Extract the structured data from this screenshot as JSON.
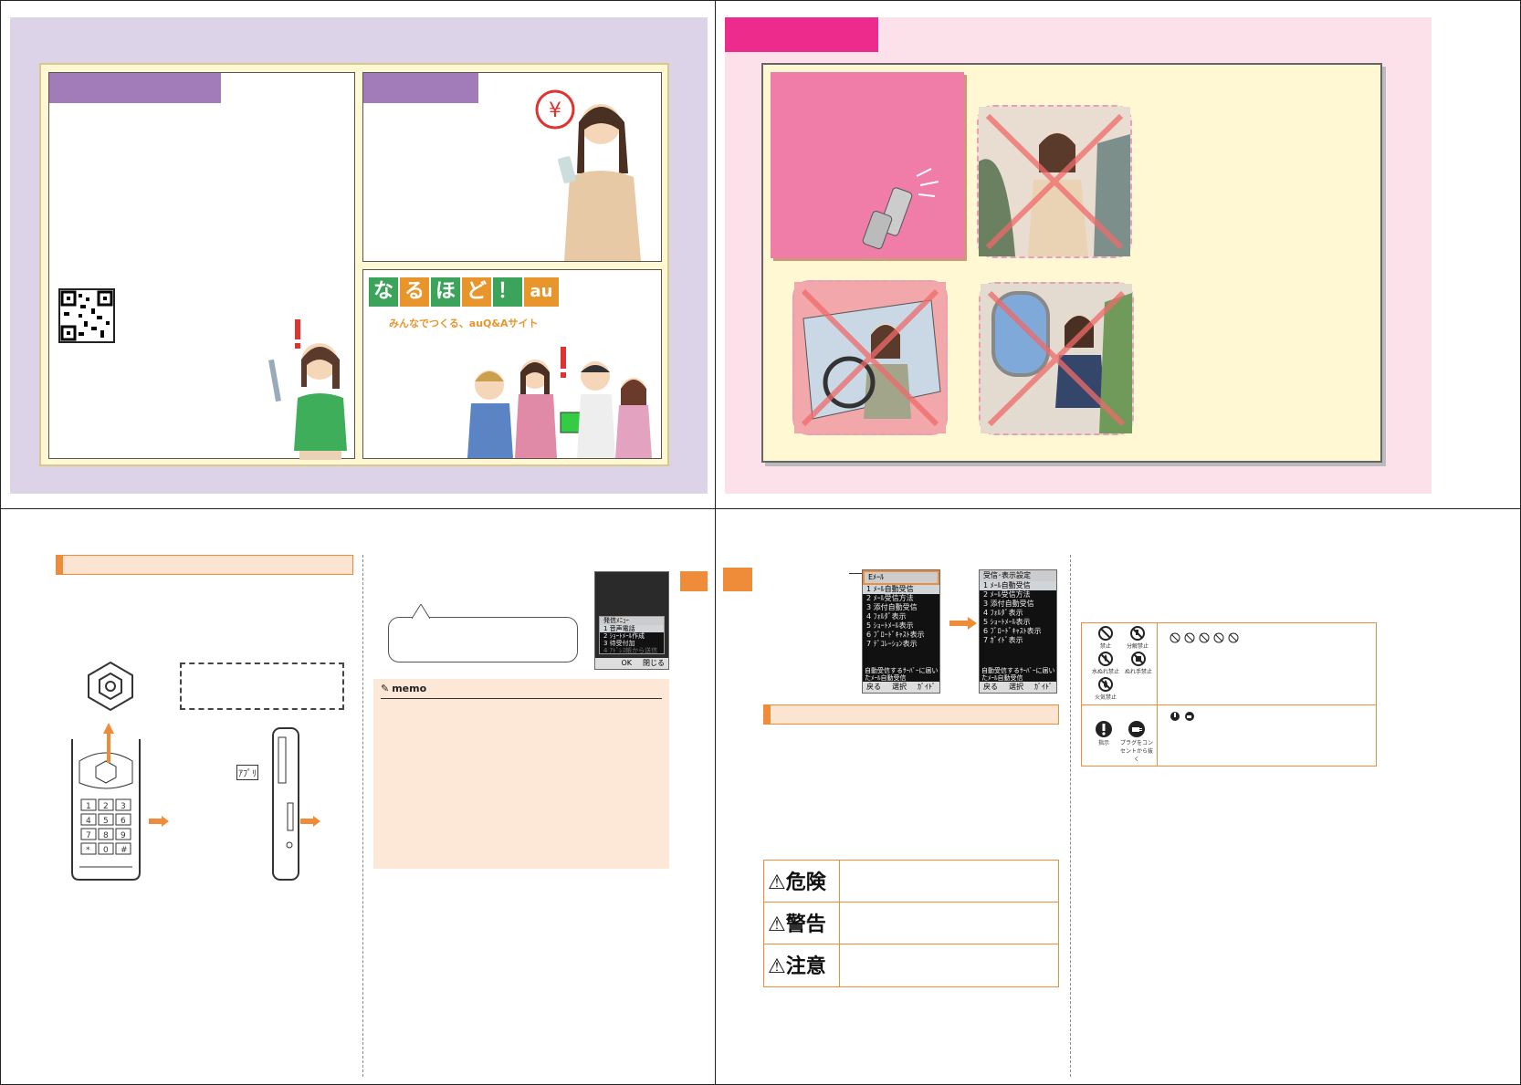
{
  "colors": {
    "lavender_bg": "#dcd3e8",
    "pink_bg": "#fde1ea",
    "cream": "#fff8d2",
    "purple_tab": "#a27bb9",
    "magenta_tab": "#ec2b8c",
    "orange": "#ef8c3a",
    "pink_panel": "#f07ca8"
  },
  "q2": {
    "logo_chars": [
      "な",
      "る",
      "ほ",
      "ど",
      "！",
      "au"
    ],
    "logo_tagline": "みんなでつくる、auQ&Aサイト"
  },
  "q3": {
    "apps_key": "ｱﾌﾟﾘ",
    "phone_menu": {
      "title": "発信ﾒﾆｭｰ",
      "items": [
        "1 音声電話",
        "2 ｼｮｰﾄﾒｰﾙ作成",
        "3 待受付加",
        "4 ｱﾄﾞﾚｽ帳から送信"
      ],
      "softkeys": [
        "OK",
        "閉じる"
      ]
    },
    "memo_label": "memo"
  },
  "q4": {
    "screen1": {
      "header": "Eﾒｰﾙ",
      "items": [
        "1 ﾒｰﾙ自動受信",
        "2 ﾒｰﾙ受信方法",
        "3 添付自動受信",
        "4 ﾌｫﾙﾀﾞ表示",
        "5 ｼｮｰﾄﾒｰﾙ表示",
        "6 ﾌﾞﾛｰﾄﾞｷｬｽﾄ表示",
        "7 ﾃﾞｺﾚｰｼｮﾝ表示"
      ],
      "footer_text": "自動受信するｻｰﾊﾞｰに届いたﾒｰﾙ自動受信",
      "softkeys": [
        "戻る",
        "選択",
        "ｶﾞｲﾄﾞ"
      ]
    },
    "screen2": {
      "header": "受信･表示設定",
      "items": [
        "1 ﾒｰﾙ自動受信",
        "2 ﾒｰﾙ受信方法",
        "3 添付自動受信",
        "4 ﾌｫﾙﾀﾞ表示",
        "5 ｼｮｰﾄﾒｰﾙ表示",
        "6 ﾌﾞﾛｰﾄﾞｷｬｽﾄ表示",
        "7 ｶﾞｲﾄﾞ表示"
      ],
      "footer_text": "自動受信するｻｰﾊﾞｰに届いたﾒｰﾙ自動受信",
      "softkeys": [
        "戻る",
        "選択",
        "ｶﾞｲﾄﾞ"
      ]
    },
    "warnings": [
      "⚠危険",
      "⚠警告",
      "⚠注意"
    ],
    "symbols_row1": [
      {
        "icon": "prohibited-icon",
        "label": "禁止"
      },
      {
        "icon": "no-disassembly-icon",
        "label": "分解禁止"
      },
      {
        "icon": "no-water-icon",
        "label": "水ぬれ禁止"
      },
      {
        "icon": "no-wet-hands-icon",
        "label": "ぬれ手禁止"
      },
      {
        "icon": "no-fire-icon",
        "label": "火気禁止"
      }
    ],
    "symbols_row2": [
      {
        "icon": "instruction-icon",
        "label": "指示"
      },
      {
        "icon": "unplug-icon",
        "label": "プラグをコンセントから抜く"
      }
    ]
  }
}
